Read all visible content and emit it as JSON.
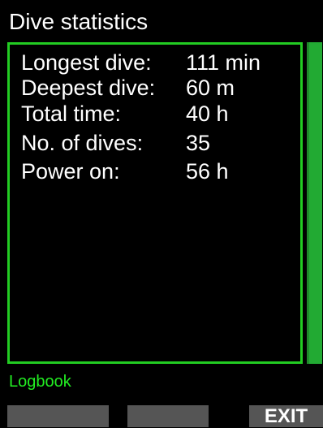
{
  "header": {
    "title": "Dive statistics"
  },
  "stats": [
    {
      "label": "Longest dive:",
      "value": "111 min"
    },
    {
      "label": "Deepest dive:",
      "value": "60 m"
    },
    {
      "label": "Total time:",
      "value": "40 h"
    },
    {
      "label": "No. of dives:",
      "value": "35"
    },
    {
      "label": "Power on:",
      "value": "56 h"
    }
  ],
  "footer": {
    "section_label": "Logbook",
    "softkeys": {
      "left": "",
      "center": "",
      "right": "EXIT"
    }
  },
  "colors": {
    "accent_green": "#22cc22",
    "label_green": "#22ee22",
    "softkey_bg": "#555555"
  }
}
